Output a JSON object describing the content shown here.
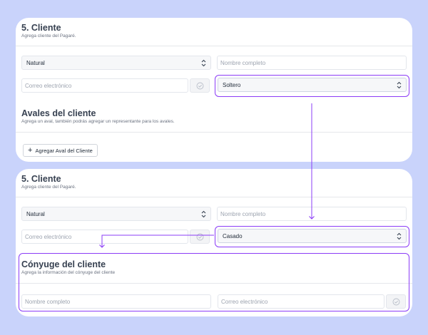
{
  "before": {
    "section_title": "5. Cliente",
    "section_subtitle": "Agrega cliente del Pagaré.",
    "person_type": "Natural",
    "full_name_placeholder": "Nombre completo",
    "email_placeholder": "Correo electrónico",
    "civil_status": "Soltero",
    "guarantors_title": "Avales del cliente",
    "guarantors_subtitle": "Agrega un aval, también podrás agregar un representante para los avales.",
    "add_guarantor_label": "Agregar Aval del Cliente"
  },
  "after": {
    "section_title": "5. Cliente",
    "section_subtitle": "Agrega cliente del Pagaré.",
    "person_type": "Natural",
    "full_name_placeholder": "Nombre completo",
    "email_placeholder": "Correo electrónico",
    "civil_status": "Casado",
    "spouse_title": "Cónyuge del cliente",
    "spouse_subtitle": "Agrega la información del cónyuge del cliente",
    "spouse_name_placeholder": "Nombre completo",
    "spouse_email_placeholder": "Correo electrónico"
  },
  "colors": {
    "background": "#c9d3fb",
    "highlight": "#8b3cf7"
  },
  "icons": {
    "select": "chevron-updown-icon",
    "verify": "check-circle-icon",
    "add": "plus-icon"
  }
}
